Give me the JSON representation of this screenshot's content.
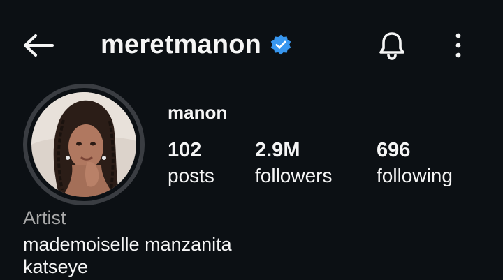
{
  "header": {
    "username": "meretmanon",
    "verified_color": "#3897f0",
    "icons": [
      "back-arrow-icon",
      "verified-badge-icon",
      "bell-icon",
      "more-vertical-icon"
    ]
  },
  "profile": {
    "display_name": "manon",
    "stats": [
      {
        "value": "102",
        "label": "posts"
      },
      {
        "value": "2.9M",
        "label": "followers"
      },
      {
        "value": "696",
        "label": "following"
      }
    ],
    "category": "Artist",
    "bio": [
      "mademoiselle manzanita",
      "katseye"
    ]
  },
  "theme": {
    "background": "#0c1014",
    "text": "#f5f5f5",
    "muted": "#a8a8a8"
  }
}
